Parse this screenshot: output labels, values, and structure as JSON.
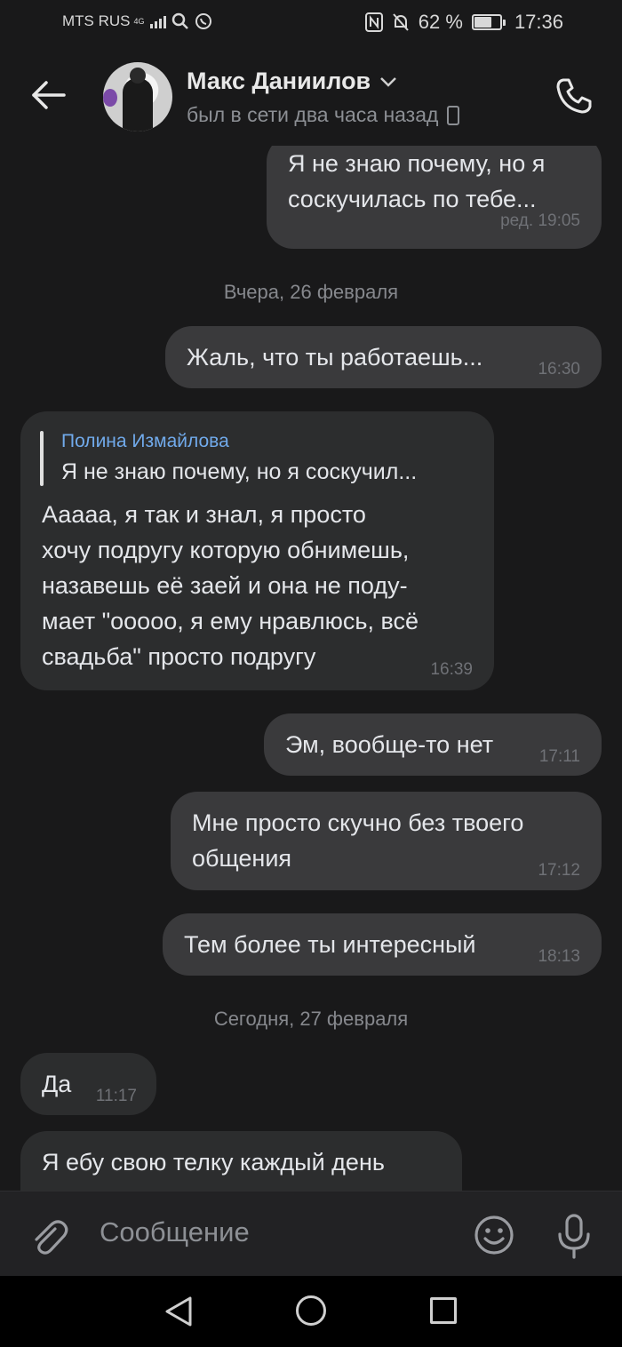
{
  "status": {
    "carrier": "MTS RUS",
    "network": "4G",
    "battery": "62 %",
    "battery_level": 0.62,
    "time": "17:36"
  },
  "header": {
    "name": "Макс Даниилов",
    "status": "был в сети два часа назад"
  },
  "dates": {
    "yesterday": "Вчера, 26 февраля",
    "today": "Сегодня, 27 февраля"
  },
  "messages": [
    {
      "dir": "out",
      "text": "Я не знаю почему, но я\nсоскучилась по тебе...",
      "time": "ред. 19:05"
    },
    {
      "dir": "out",
      "text": "Жаль, что ты работаешь...",
      "time": "16:30"
    },
    {
      "dir": "in",
      "reply_name": "Полина Измайлова",
      "reply_text": "Я не знаю почему, но я соскучил...",
      "text": "Ааааа, я так и знал, я просто\nхочу подругу которую обнимешь,\nназавешь её заей и она не поду-\nмает \"ооооо, я ему нравлюсь, всё\nсвадьба\" просто подругу",
      "time": "16:39"
    },
    {
      "dir": "out",
      "text": "Эм, вообще-то нет",
      "time": "17:11"
    },
    {
      "dir": "out",
      "text": "Мне просто скучно без твоего\nобщения",
      "time": "17:12"
    },
    {
      "dir": "out",
      "text": "Тем более ты интересный",
      "time": "18:13"
    },
    {
      "dir": "in",
      "text": "Да",
      "time": "11:17"
    },
    {
      "dir": "in",
      "text": "Я ебу свою телку каждый день",
      "time": ""
    }
  ],
  "composer": {
    "placeholder": "Сообщение"
  },
  "icons": {
    "back": "arrow-left-icon",
    "call": "phone-icon",
    "attach": "paperclip-icon",
    "emoji": "smile-icon",
    "voice": "microphone-icon"
  }
}
